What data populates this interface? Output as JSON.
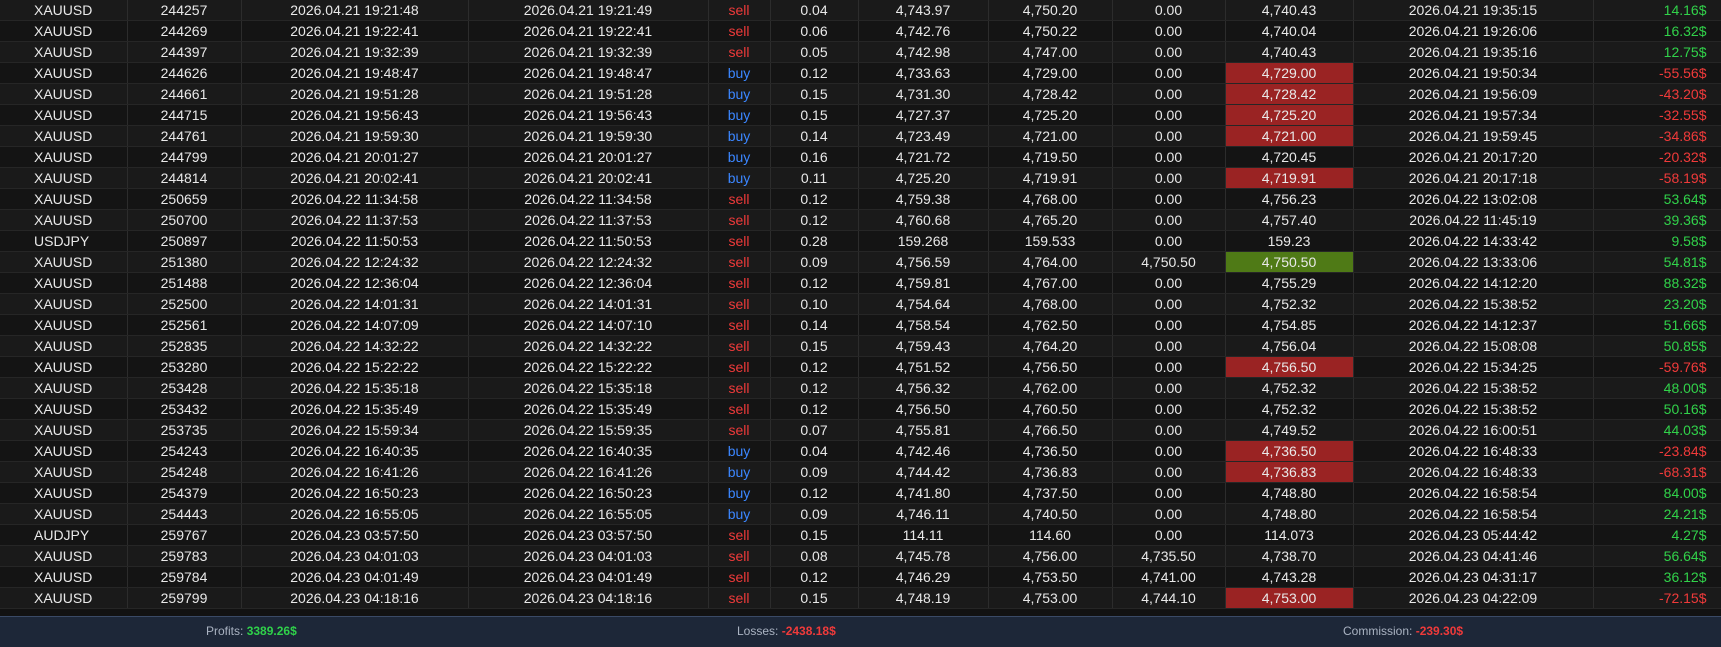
{
  "colors": {
    "sell": "#f03a3a",
    "buy": "#3b86ff",
    "profit_positive": "#31d24a",
    "profit_negative": "#f03a3a",
    "close_loss_highlight": "#9a2323",
    "close_win_highlight": "#4f7a16",
    "summary_bar": "#1d2738"
  },
  "trades": [
    {
      "symbol": "XAUUSD",
      "ticket": "244257",
      "open_time": "2026.04.21 19:21:48",
      "exec_time": "2026.04.21 19:21:49",
      "type": "sell",
      "volume": "0.04",
      "open_price": "4,743.97",
      "sl": "4,750.20",
      "tp": "0.00",
      "close_price": "4,740.43",
      "close_time": "2026.04.21 19:35:15",
      "profit": "14.16$",
      "highlight": "none"
    },
    {
      "symbol": "XAUUSD",
      "ticket": "244269",
      "open_time": "2026.04.21 19:22:41",
      "exec_time": "2026.04.21 19:22:41",
      "type": "sell",
      "volume": "0.06",
      "open_price": "4,742.76",
      "sl": "4,750.22",
      "tp": "0.00",
      "close_price": "4,740.04",
      "close_time": "2026.04.21 19:26:06",
      "profit": "16.32$",
      "highlight": "none"
    },
    {
      "symbol": "XAUUSD",
      "ticket": "244397",
      "open_time": "2026.04.21 19:32:39",
      "exec_time": "2026.04.21 19:32:39",
      "type": "sell",
      "volume": "0.05",
      "open_price": "4,742.98",
      "sl": "4,747.00",
      "tp": "0.00",
      "close_price": "4,740.43",
      "close_time": "2026.04.21 19:35:16",
      "profit": "12.75$",
      "highlight": "none"
    },
    {
      "symbol": "XAUUSD",
      "ticket": "244626",
      "open_time": "2026.04.21 19:48:47",
      "exec_time": "2026.04.21 19:48:47",
      "type": "buy",
      "volume": "0.12",
      "open_price": "4,733.63",
      "sl": "4,729.00",
      "tp": "0.00",
      "close_price": "4,729.00",
      "close_time": "2026.04.21 19:50:34",
      "profit": "-55.56$",
      "highlight": "loss"
    },
    {
      "symbol": "XAUUSD",
      "ticket": "244661",
      "open_time": "2026.04.21 19:51:28",
      "exec_time": "2026.04.21 19:51:28",
      "type": "buy",
      "volume": "0.15",
      "open_price": "4,731.30",
      "sl": "4,728.42",
      "tp": "0.00",
      "close_price": "4,728.42",
      "close_time": "2026.04.21 19:56:09",
      "profit": "-43.20$",
      "highlight": "loss"
    },
    {
      "symbol": "XAUUSD",
      "ticket": "244715",
      "open_time": "2026.04.21 19:56:43",
      "exec_time": "2026.04.21 19:56:43",
      "type": "buy",
      "volume": "0.15",
      "open_price": "4,727.37",
      "sl": "4,725.20",
      "tp": "0.00",
      "close_price": "4,725.20",
      "close_time": "2026.04.21 19:57:34",
      "profit": "-32.55$",
      "highlight": "loss"
    },
    {
      "symbol": "XAUUSD",
      "ticket": "244761",
      "open_time": "2026.04.21 19:59:30",
      "exec_time": "2026.04.21 19:59:30",
      "type": "buy",
      "volume": "0.14",
      "open_price": "4,723.49",
      "sl": "4,721.00",
      "tp": "0.00",
      "close_price": "4,721.00",
      "close_time": "2026.04.21 19:59:45",
      "profit": "-34.86$",
      "highlight": "loss"
    },
    {
      "symbol": "XAUUSD",
      "ticket": "244799",
      "open_time": "2026.04.21 20:01:27",
      "exec_time": "2026.04.21 20:01:27",
      "type": "buy",
      "volume": "0.16",
      "open_price": "4,721.72",
      "sl": "4,719.50",
      "tp": "0.00",
      "close_price": "4,720.45",
      "close_time": "2026.04.21 20:17:20",
      "profit": "-20.32$",
      "highlight": "none"
    },
    {
      "symbol": "XAUUSD",
      "ticket": "244814",
      "open_time": "2026.04.21 20:02:41",
      "exec_time": "2026.04.21 20:02:41",
      "type": "buy",
      "volume": "0.11",
      "open_price": "4,725.20",
      "sl": "4,719.91",
      "tp": "0.00",
      "close_price": "4,719.91",
      "close_time": "2026.04.21 20:17:18",
      "profit": "-58.19$",
      "highlight": "loss"
    },
    {
      "symbol": "XAUUSD",
      "ticket": "250659",
      "open_time": "2026.04.22 11:34:58",
      "exec_time": "2026.04.22 11:34:58",
      "type": "sell",
      "volume": "0.12",
      "open_price": "4,759.38",
      "sl": "4,768.00",
      "tp": "0.00",
      "close_price": "4,756.23",
      "close_time": "2026.04.22 13:02:08",
      "profit": "53.64$",
      "highlight": "none"
    },
    {
      "symbol": "XAUUSD",
      "ticket": "250700",
      "open_time": "2026.04.22 11:37:53",
      "exec_time": "2026.04.22 11:37:53",
      "type": "sell",
      "volume": "0.12",
      "open_price": "4,760.68",
      "sl": "4,765.20",
      "tp": "0.00",
      "close_price": "4,757.40",
      "close_time": "2026.04.22 11:45:19",
      "profit": "39.36$",
      "highlight": "none"
    },
    {
      "symbol": "USDJPY",
      "ticket": "250897",
      "open_time": "2026.04.22 11:50:53",
      "exec_time": "2026.04.22 11:50:53",
      "type": "sell",
      "volume": "0.28",
      "open_price": "159.268",
      "sl": "159.533",
      "tp": "0.00",
      "close_price": "159.23",
      "close_time": "2026.04.22 14:33:42",
      "profit": "9.58$",
      "highlight": "none"
    },
    {
      "symbol": "XAUUSD",
      "ticket": "251380",
      "open_time": "2026.04.22 12:24:32",
      "exec_time": "2026.04.22 12:24:32",
      "type": "sell",
      "volume": "0.09",
      "open_price": "4,756.59",
      "sl": "4,764.00",
      "tp": "4,750.50",
      "close_price": "4,750.50",
      "close_time": "2026.04.22 13:33:06",
      "profit": "54.81$",
      "highlight": "win"
    },
    {
      "symbol": "XAUUSD",
      "ticket": "251488",
      "open_time": "2026.04.22 12:36:04",
      "exec_time": "2026.04.22 12:36:04",
      "type": "sell",
      "volume": "0.12",
      "open_price": "4,759.81",
      "sl": "4,767.00",
      "tp": "0.00",
      "close_price": "4,755.29",
      "close_time": "2026.04.22 14:12:20",
      "profit": "88.32$",
      "highlight": "none"
    },
    {
      "symbol": "XAUUSD",
      "ticket": "252500",
      "open_time": "2026.04.22 14:01:31",
      "exec_time": "2026.04.22 14:01:31",
      "type": "sell",
      "volume": "0.10",
      "open_price": "4,754.64",
      "sl": "4,768.00",
      "tp": "0.00",
      "close_price": "4,752.32",
      "close_time": "2026.04.22 15:38:52",
      "profit": "23.20$",
      "highlight": "none"
    },
    {
      "symbol": "XAUUSD",
      "ticket": "252561",
      "open_time": "2026.04.22 14:07:09",
      "exec_time": "2026.04.22 14:07:10",
      "type": "sell",
      "volume": "0.14",
      "open_price": "4,758.54",
      "sl": "4,762.50",
      "tp": "0.00",
      "close_price": "4,754.85",
      "close_time": "2026.04.22 14:12:37",
      "profit": "51.66$",
      "highlight": "none"
    },
    {
      "symbol": "XAUUSD",
      "ticket": "252835",
      "open_time": "2026.04.22 14:32:22",
      "exec_time": "2026.04.22 14:32:22",
      "type": "sell",
      "volume": "0.15",
      "open_price": "4,759.43",
      "sl": "4,764.20",
      "tp": "0.00",
      "close_price": "4,756.04",
      "close_time": "2026.04.22 15:08:08",
      "profit": "50.85$",
      "highlight": "none"
    },
    {
      "symbol": "XAUUSD",
      "ticket": "253280",
      "open_time": "2026.04.22 15:22:22",
      "exec_time": "2026.04.22 15:22:22",
      "type": "sell",
      "volume": "0.12",
      "open_price": "4,751.52",
      "sl": "4,756.50",
      "tp": "0.00",
      "close_price": "4,756.50",
      "close_time": "2026.04.22 15:34:25",
      "profit": "-59.76$",
      "highlight": "loss"
    },
    {
      "symbol": "XAUUSD",
      "ticket": "253428",
      "open_time": "2026.04.22 15:35:18",
      "exec_time": "2026.04.22 15:35:18",
      "type": "sell",
      "volume": "0.12",
      "open_price": "4,756.32",
      "sl": "4,762.00",
      "tp": "0.00",
      "close_price": "4,752.32",
      "close_time": "2026.04.22 15:38:52",
      "profit": "48.00$",
      "highlight": "none"
    },
    {
      "symbol": "XAUUSD",
      "ticket": "253432",
      "open_time": "2026.04.22 15:35:49",
      "exec_time": "2026.04.22 15:35:49",
      "type": "sell",
      "volume": "0.12",
      "open_price": "4,756.50",
      "sl": "4,760.50",
      "tp": "0.00",
      "close_price": "4,752.32",
      "close_time": "2026.04.22 15:38:52",
      "profit": "50.16$",
      "highlight": "none"
    },
    {
      "symbol": "XAUUSD",
      "ticket": "253735",
      "open_time": "2026.04.22 15:59:34",
      "exec_time": "2026.04.22 15:59:35",
      "type": "sell",
      "volume": "0.07",
      "open_price": "4,755.81",
      "sl": "4,766.50",
      "tp": "0.00",
      "close_price": "4,749.52",
      "close_time": "2026.04.22 16:00:51",
      "profit": "44.03$",
      "highlight": "none"
    },
    {
      "symbol": "XAUUSD",
      "ticket": "254243",
      "open_time": "2026.04.22 16:40:35",
      "exec_time": "2026.04.22 16:40:35",
      "type": "buy",
      "volume": "0.04",
      "open_price": "4,742.46",
      "sl": "4,736.50",
      "tp": "0.00",
      "close_price": "4,736.50",
      "close_time": "2026.04.22 16:48:33",
      "profit": "-23.84$",
      "highlight": "loss"
    },
    {
      "symbol": "XAUUSD",
      "ticket": "254248",
      "open_time": "2026.04.22 16:41:26",
      "exec_time": "2026.04.22 16:41:26",
      "type": "buy",
      "volume": "0.09",
      "open_price": "4,744.42",
      "sl": "4,736.83",
      "tp": "0.00",
      "close_price": "4,736.83",
      "close_time": "2026.04.22 16:48:33",
      "profit": "-68.31$",
      "highlight": "loss"
    },
    {
      "symbol": "XAUUSD",
      "ticket": "254379",
      "open_time": "2026.04.22 16:50:23",
      "exec_time": "2026.04.22 16:50:23",
      "type": "buy",
      "volume": "0.12",
      "open_price": "4,741.80",
      "sl": "4,737.50",
      "tp": "0.00",
      "close_price": "4,748.80",
      "close_time": "2026.04.22 16:58:54",
      "profit": "84.00$",
      "highlight": "none"
    },
    {
      "symbol": "XAUUSD",
      "ticket": "254443",
      "open_time": "2026.04.22 16:55:05",
      "exec_time": "2026.04.22 16:55:05",
      "type": "buy",
      "volume": "0.09",
      "open_price": "4,746.11",
      "sl": "4,740.50",
      "tp": "0.00",
      "close_price": "4,748.80",
      "close_time": "2026.04.22 16:58:54",
      "profit": "24.21$",
      "highlight": "none"
    },
    {
      "symbol": "AUDJPY",
      "ticket": "259767",
      "open_time": "2026.04.23 03:57:50",
      "exec_time": "2026.04.23 03:57:50",
      "type": "sell",
      "volume": "0.15",
      "open_price": "114.11",
      "sl": "114.60",
      "tp": "0.00",
      "close_price": "114.073",
      "close_time": "2026.04.23 05:44:42",
      "profit": "4.27$",
      "highlight": "none"
    },
    {
      "symbol": "XAUUSD",
      "ticket": "259783",
      "open_time": "2026.04.23 04:01:03",
      "exec_time": "2026.04.23 04:01:03",
      "type": "sell",
      "volume": "0.08",
      "open_price": "4,745.78",
      "sl": "4,756.00",
      "tp": "4,735.50",
      "close_price": "4,738.70",
      "close_time": "2026.04.23 04:41:46",
      "profit": "56.64$",
      "highlight": "none"
    },
    {
      "symbol": "XAUUSD",
      "ticket": "259784",
      "open_time": "2026.04.23 04:01:49",
      "exec_time": "2026.04.23 04:01:49",
      "type": "sell",
      "volume": "0.12",
      "open_price": "4,746.29",
      "sl": "4,753.50",
      "tp": "4,741.00",
      "close_price": "4,743.28",
      "close_time": "2026.04.23 04:31:17",
      "profit": "36.12$",
      "highlight": "none"
    },
    {
      "symbol": "XAUUSD",
      "ticket": "259799",
      "open_time": "2026.04.23 04:18:16",
      "exec_time": "2026.04.23 04:18:16",
      "type": "sell",
      "volume": "0.15",
      "open_price": "4,748.19",
      "sl": "4,753.00",
      "tp": "4,744.10",
      "close_price": "4,753.00",
      "close_time": "2026.04.23 04:22:09",
      "profit": "-72.15$",
      "highlight": "loss"
    }
  ],
  "summary": {
    "profits_label": "Profits:",
    "profits_value": "3389.26$",
    "losses_label": "Losses:",
    "losses_value": "-2438.18$",
    "commission_label": "Commission:",
    "commission_value": "-239.30$"
  }
}
